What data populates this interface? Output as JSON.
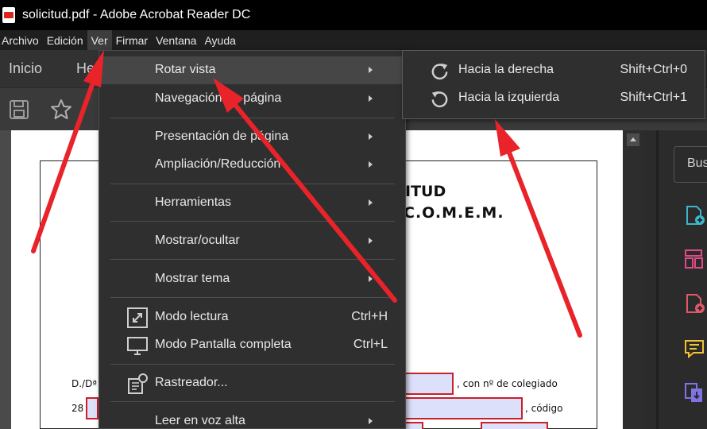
{
  "window": {
    "title": "solicitud.pdf - Adobe Acrobat Reader DC"
  },
  "menubar": {
    "items": [
      "Archivo",
      "Edición",
      "Ver",
      "Firmar",
      "Ventana",
      "Ayuda"
    ],
    "active": "Ver"
  },
  "tabs": {
    "inicio": "Inicio",
    "herramientas_partial": "He"
  },
  "ver_menu": {
    "items": [
      {
        "label": "Rotar vista",
        "has_submenu": true
      },
      {
        "label": "Navegación de página",
        "has_submenu": true
      },
      {
        "label": "Presentación de página",
        "has_submenu": true
      },
      {
        "label": "Ampliación/Reducción",
        "has_submenu": true
      },
      {
        "label": "Herramientas",
        "has_submenu": true
      },
      {
        "label": "Mostrar/ocultar",
        "has_submenu": true
      },
      {
        "label": "Mostrar tema",
        "has_submenu": true
      },
      {
        "label": "Modo lectura",
        "shortcut": "Ctrl+H"
      },
      {
        "label": "Modo Pantalla completa",
        "shortcut": "Ctrl+L"
      },
      {
        "label": "Rastreador..."
      },
      {
        "label": "Leer en voz alta",
        "has_submenu": true
      }
    ]
  },
  "rotate_submenu": {
    "items": [
      {
        "label": "Hacia la derecha",
        "shortcut": "Shift+Ctrl+0"
      },
      {
        "label": "Hacia la izquierda",
        "shortcut": "Shift+Ctrl+1"
      }
    ]
  },
  "document": {
    "title_line1": "ITUD",
    "title_line2": "C.O.M.E.M.",
    "line1_prefix": "D./Dª",
    "line1_suffix": ", con nº de colegiado",
    "line2_prefix": "28",
    "line2_suffix": ", código"
  },
  "right_panel": {
    "search_partial": "Bus"
  },
  "colors": {
    "annotation_arrow": "#e8232a",
    "form_field_border": "#c9202a",
    "form_field_fill": "#dde0fb"
  }
}
